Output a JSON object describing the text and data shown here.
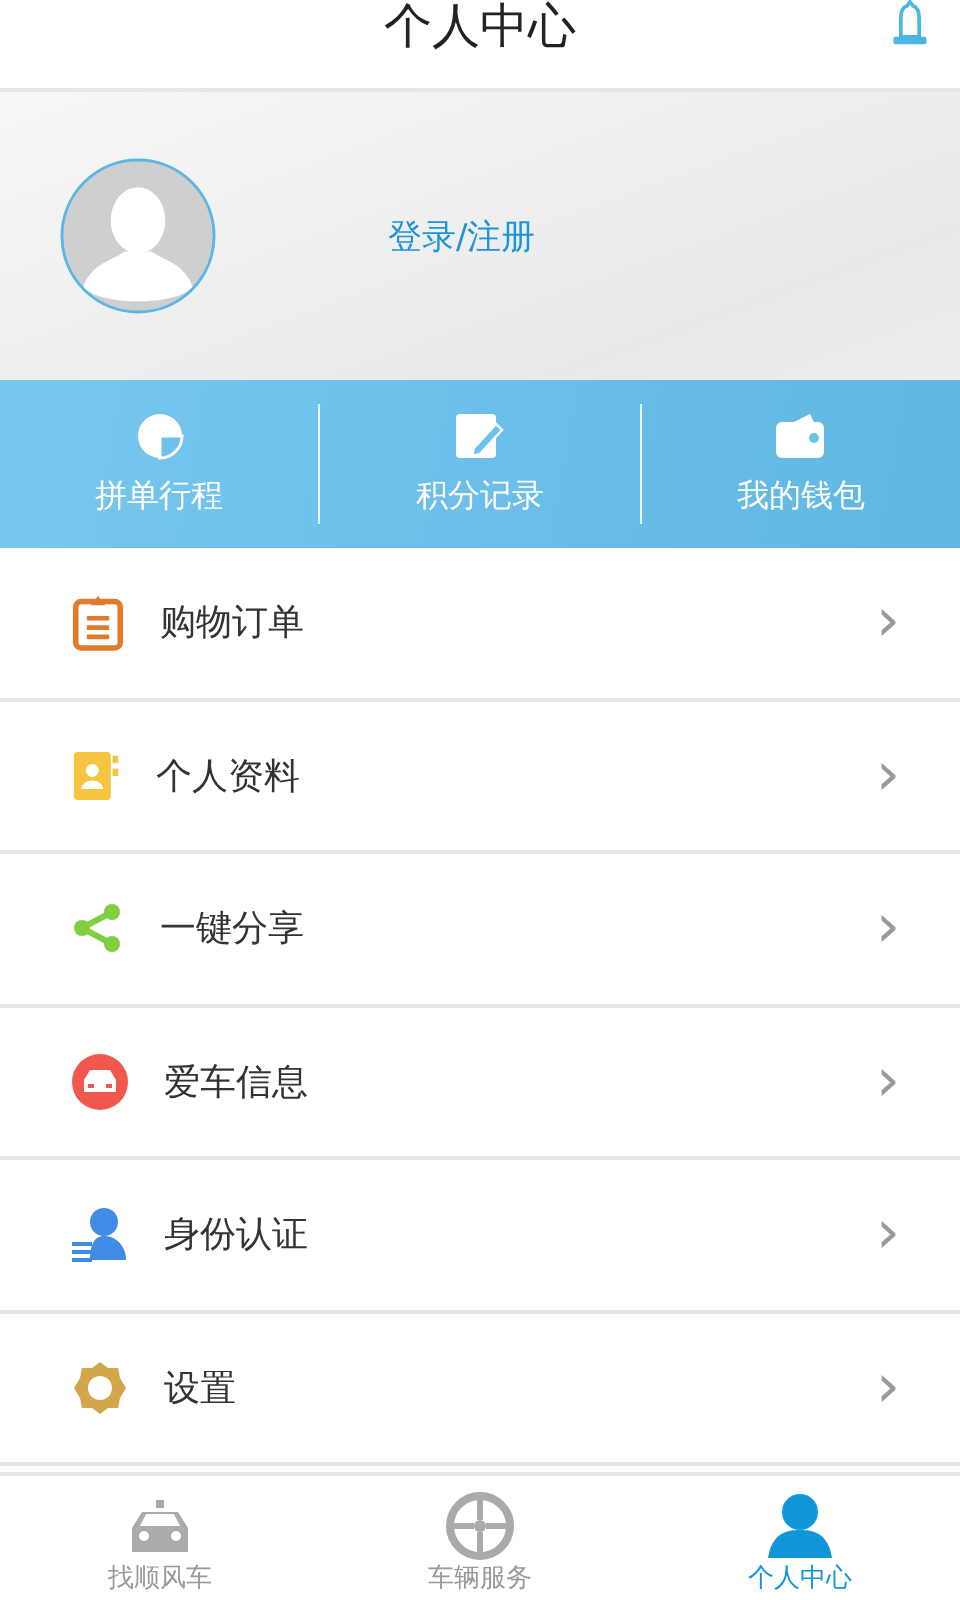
{
  "header": {
    "title": "个人中心"
  },
  "profile": {
    "login_label": "登录/注册"
  },
  "quick_actions": [
    {
      "kind": "trip",
      "label": "拼单行程"
    },
    {
      "kind": "points",
      "label": "积分记录"
    },
    {
      "kind": "wallet",
      "label": "我的钱包"
    }
  ],
  "menu": [
    {
      "kind": "orders",
      "label": "购物订单",
      "chevron": "›"
    },
    {
      "kind": "profile",
      "label": "个人资料",
      "chevron": "›"
    },
    {
      "kind": "share",
      "label": "一键分享",
      "chevron": "›"
    },
    {
      "kind": "car",
      "label": "爱车信息",
      "chevron": "›"
    },
    {
      "kind": "identity",
      "label": "身份认证",
      "chevron": "›"
    },
    {
      "kind": "settings",
      "label": "设置",
      "chevron": "›"
    }
  ],
  "tab_bar": [
    {
      "kind": "taxi",
      "label": "找顺风车",
      "selected": false
    },
    {
      "kind": "wheel",
      "label": "车辆服务",
      "selected": false
    },
    {
      "kind": "person",
      "label": "个人中心",
      "selected": true
    }
  ]
}
